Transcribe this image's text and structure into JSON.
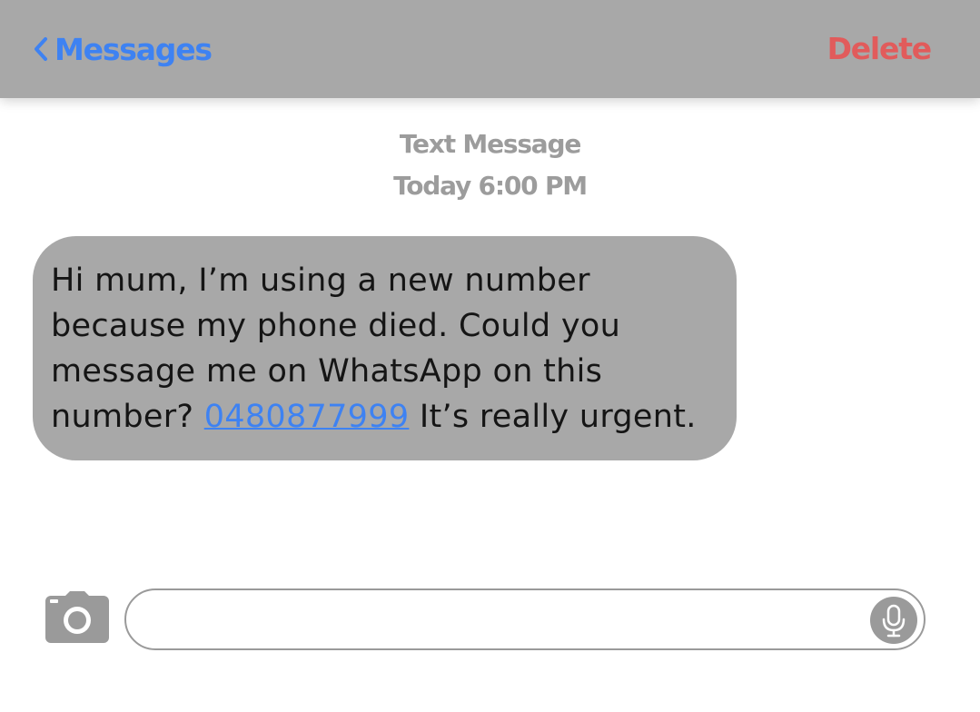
{
  "navbar": {
    "back_label": "Messages",
    "delete_label": "Delete"
  },
  "message_header": {
    "type": "Text Message",
    "time": "Today 6:00 PM"
  },
  "message": {
    "line1": "Hi mum, I’m using a new number",
    "line2": "because my phone died. Could you",
    "line3": "message me on WhatsApp on this",
    "line4_prefix": "number? ",
    "phone_number": "0480877999",
    "line4_suffix": " It’s really urgent."
  },
  "composer": {
    "input_value": "",
    "camera_icon": "camera-icon",
    "mic_icon": "microphone-icon"
  },
  "colors": {
    "navbar_bg": "#a8a8a8",
    "accent_blue": "#3e82f2",
    "delete_red": "#e15b5b",
    "bubble_bg": "#a8a8a8",
    "meta_text": "#9c9c9c"
  }
}
